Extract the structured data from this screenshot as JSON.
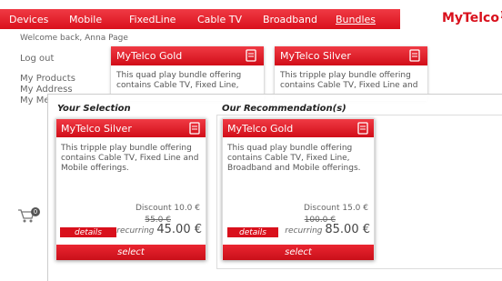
{
  "nav": {
    "items": [
      "Devices",
      "Mobile",
      "FixedLine",
      "Cable TV",
      "Broadband",
      "Bundles"
    ],
    "active_index": 5
  },
  "logo": {
    "text": "MyTelco"
  },
  "welcome": "Welcome back, Anna Page",
  "sidebar": {
    "logout": "Log out",
    "products": "My Products",
    "address": "My Address",
    "more": "My Me"
  },
  "background_tiles": [
    {
      "title": "MyTelco Gold",
      "desc": "This quad play bundle offering contains Cable TV, Fixed Line,"
    },
    {
      "title": "MyTelco Silver",
      "desc": "This tripple play bundle offering contains Cable TV, Fixed Line and"
    }
  ],
  "cart": {
    "count": "0"
  },
  "selection": {
    "heading": "Your Selection",
    "title": "MyTelco Silver",
    "desc": "This tripple play bundle offering contains Cable TV, Fixed Line and Mobile offerings.",
    "discount": "Discount 10.0 €",
    "old_price": "55.0 €",
    "recurring_label": "recurring",
    "price": "45.00 €",
    "details": "details",
    "select": "select"
  },
  "recommendation": {
    "heading": "Our Recommendation(s)",
    "title": "MyTelco Gold",
    "desc": "This quad play bundle offering contains Cable TV, Fixed Line, Broadband and Mobile offerings.",
    "discount": "Discount 15.0 €",
    "old_price": "100.0 €",
    "recurring_label": "recurring",
    "price": "85.00 €",
    "details": "details",
    "select": "select"
  },
  "colors": {
    "brand_red": "#d9101c",
    "text_gray": "#555555"
  }
}
